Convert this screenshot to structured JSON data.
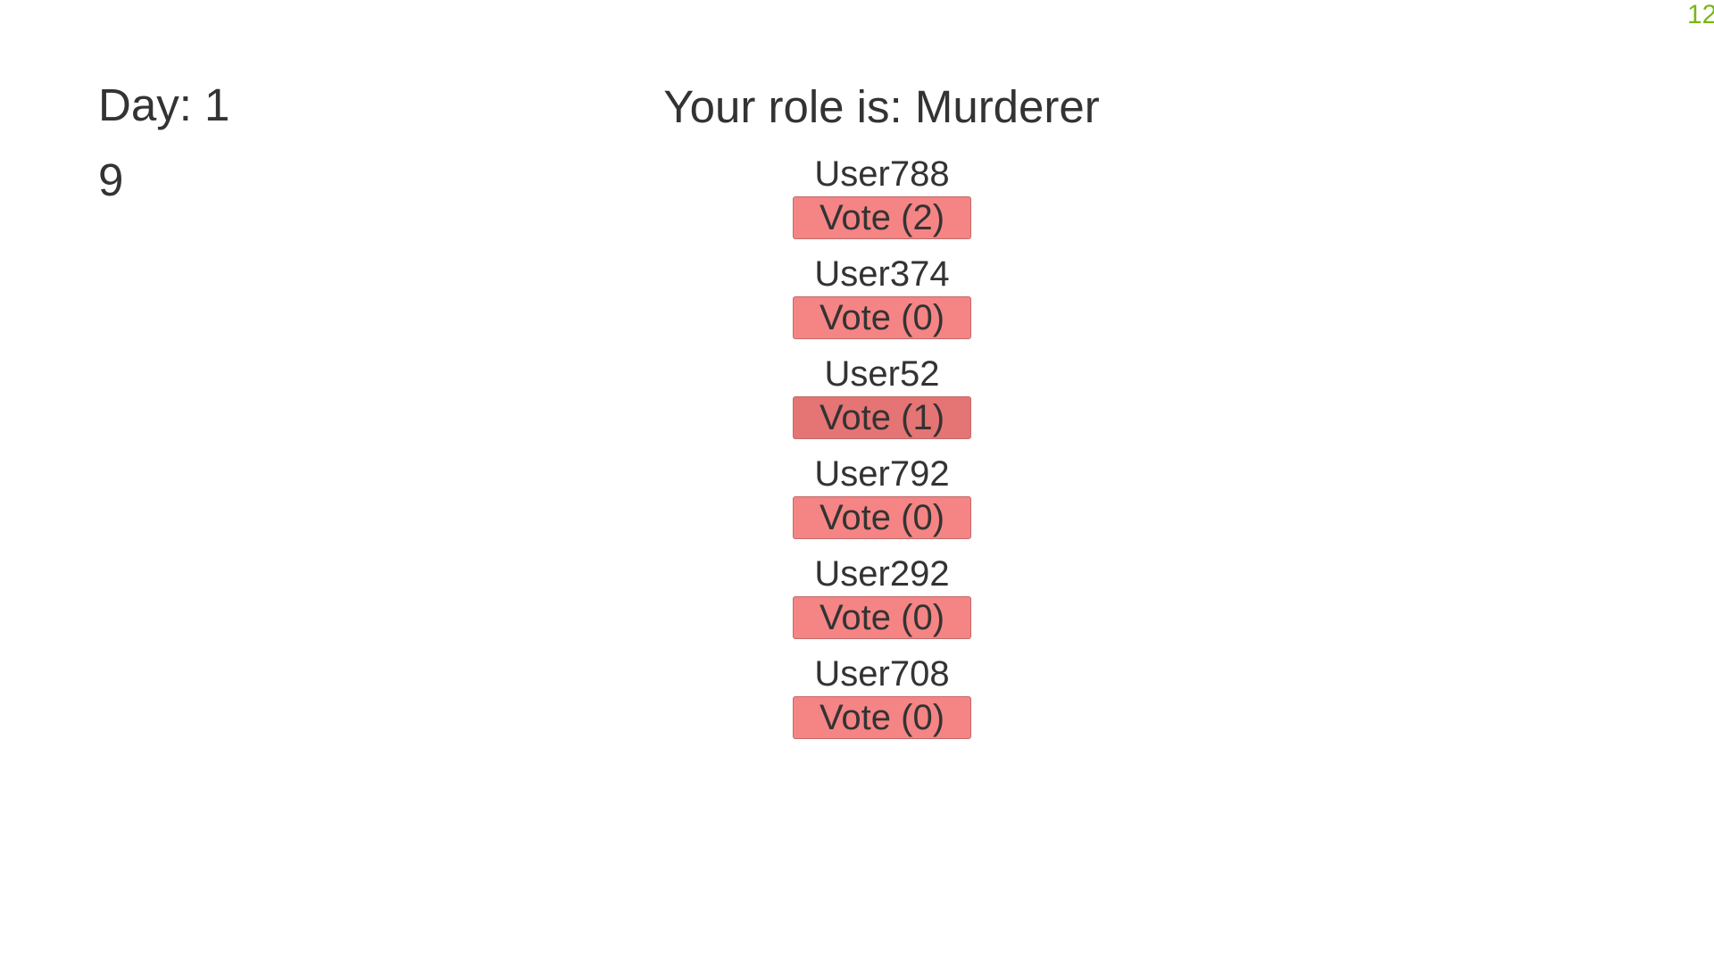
{
  "corner_counter": "12",
  "day_label": "Day: 1",
  "timer": "9",
  "role_line": "Your role is: Murderer",
  "players": [
    {
      "name": "User788",
      "vote_label": "Vote (2)"
    },
    {
      "name": "User374",
      "vote_label": "Vote (0)"
    },
    {
      "name": "User52",
      "vote_label": "Vote (1)"
    },
    {
      "name": "User792",
      "vote_label": "Vote (0)"
    },
    {
      "name": "User292",
      "vote_label": "Vote (0)"
    },
    {
      "name": "User708",
      "vote_label": "Vote (0)"
    }
  ],
  "colors": {
    "vote_button": "#f58484",
    "vote_button_hovered": "#e57474",
    "corner_counter": "#7cb518",
    "text": "#333333"
  }
}
